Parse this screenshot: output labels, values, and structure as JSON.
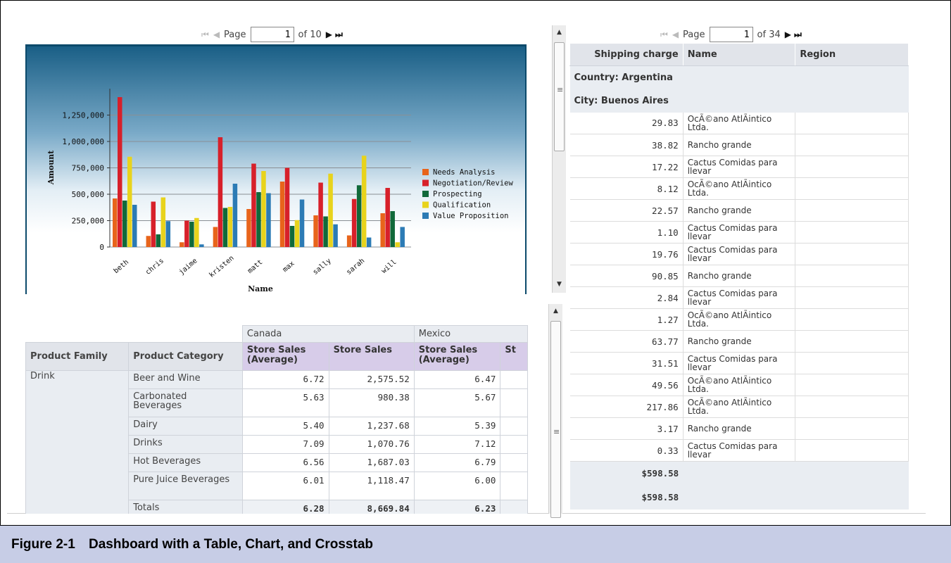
{
  "chart_pager": {
    "first": "⏮",
    "prev": "◀",
    "label": "Page",
    "page": "1",
    "of": "of 10",
    "next": "▶",
    "last": "⏭"
  },
  "table_pager": {
    "first": "⏮",
    "prev": "◀",
    "label": "Page",
    "page": "1",
    "of": "of 34",
    "next": "▶",
    "last": "⏭"
  },
  "colors": {
    "needs": "#e8641b",
    "negotiation": "#d7202a",
    "prospecting": "#10693a",
    "qualification": "#e8d31c",
    "value": "#2c7bb5",
    "chart_top": "#1a5f86"
  },
  "chart_data": {
    "type": "bar",
    "title": "",
    "xlabel": "Name",
    "ylabel": "Amount",
    "ylim": [
      0,
      1500000
    ],
    "yticks": [
      "0",
      "250,000",
      "500,000",
      "750,000",
      "1,000,000",
      "1,250,000"
    ],
    "tick_values": [
      0,
      250000,
      500000,
      750000,
      1000000,
      1250000
    ],
    "categories": [
      "beth",
      "chris",
      "jaime",
      "kristen",
      "matt",
      "max",
      "sally",
      "sarah",
      "will"
    ],
    "legend_position": "right",
    "series": [
      {
        "name": "Needs Analysis",
        "color": "#e8641b",
        "values": [
          460000,
          105000,
          45000,
          190000,
          360000,
          620000,
          300000,
          110000,
          320000
        ]
      },
      {
        "name": "Negotiation/Review",
        "color": "#d7202a",
        "values": [
          1420000,
          430000,
          250000,
          1040000,
          790000,
          750000,
          610000,
          455000,
          560000
        ]
      },
      {
        "name": "Prospecting",
        "color": "#10693a",
        "values": [
          440000,
          120000,
          240000,
          370000,
          520000,
          200000,
          290000,
          585000,
          340000
        ]
      },
      {
        "name": "Qualification",
        "color": "#e8d31c",
        "values": [
          855000,
          470000,
          275000,
          380000,
          720000,
          255000,
          695000,
          865000,
          45000
        ]
      },
      {
        "name": "Value Proposition",
        "color": "#2c7bb5",
        "values": [
          400000,
          245000,
          25000,
          600000,
          510000,
          450000,
          215000,
          90000,
          190000
        ]
      }
    ]
  },
  "table": {
    "headers": [
      "Shipping charge",
      "Name",
      "Region"
    ],
    "group_country": "Country: Argentina",
    "group_city": "City: Buenos Aires",
    "rows": [
      {
        "charge": "29.83",
        "name": "OcÃ©ano AtlÃintico Ltda."
      },
      {
        "charge": "38.82",
        "name": "Rancho grande"
      },
      {
        "charge": "17.22",
        "name": "Cactus Comidas para llevar"
      },
      {
        "charge": "8.12",
        "name": "OcÃ©ano AtlÃintico Ltda."
      },
      {
        "charge": "22.57",
        "name": "Rancho grande"
      },
      {
        "charge": "1.10",
        "name": "Cactus Comidas para llevar"
      },
      {
        "charge": "19.76",
        "name": "Cactus Comidas para llevar"
      },
      {
        "charge": "90.85",
        "name": "Rancho grande"
      },
      {
        "charge": "2.84",
        "name": "Cactus Comidas para llevar"
      },
      {
        "charge": "1.27",
        "name": "OcÃ©ano AtlÃintico Ltda."
      },
      {
        "charge": "63.77",
        "name": "Rancho grande"
      },
      {
        "charge": "31.51",
        "name": "Cactus Comidas para llevar"
      },
      {
        "charge": "49.56",
        "name": "OcÃ©ano AtlÃintico Ltda."
      },
      {
        "charge": "217.86",
        "name": "OcÃ©ano AtlÃintico Ltda."
      },
      {
        "charge": "3.17",
        "name": "Rancho grande"
      },
      {
        "charge": "0.33",
        "name": "Cactus Comidas para llevar"
      }
    ],
    "total1": "$598.58",
    "total2": "$598.58"
  },
  "crosstab": {
    "country_headers": [
      "Canada",
      "Mexico"
    ],
    "measure_headers": [
      "Store Sales (Average)",
      "Store Sales",
      "Store Sales (Average)",
      "St"
    ],
    "dim_headers": [
      "Product Family",
      "Product Category"
    ],
    "family": "Drink",
    "rows": [
      {
        "category": "Beer and Wine",
        "v1": "6.72",
        "v2": "2,575.52",
        "v3": "6.47"
      },
      {
        "category": "Carbonated Beverages",
        "v1": "5.63",
        "v2": "980.38",
        "v3": "5.67"
      },
      {
        "category": "Dairy",
        "v1": "5.40",
        "v2": "1,237.68",
        "v3": "5.39"
      },
      {
        "category": "Drinks",
        "v1": "7.09",
        "v2": "1,070.76",
        "v3": "7.12"
      },
      {
        "category": "Hot Beverages",
        "v1": "6.56",
        "v2": "1,687.03",
        "v3": "6.79"
      },
      {
        "category": "Pure Juice Beverages",
        "v1": "6.01",
        "v2": "1,118.47",
        "v3": "6.00"
      }
    ],
    "totals": {
      "category": "Totals",
      "v1": "6.28",
      "v2": "8,669.84",
      "v3": "6.23"
    }
  },
  "scroll_icons": {
    "up": "▲",
    "down": "▼",
    "grip": "≡"
  },
  "caption": {
    "number": "Figure 2-1",
    "title": "Dashboard with a Table, Chart, and Crosstab"
  }
}
